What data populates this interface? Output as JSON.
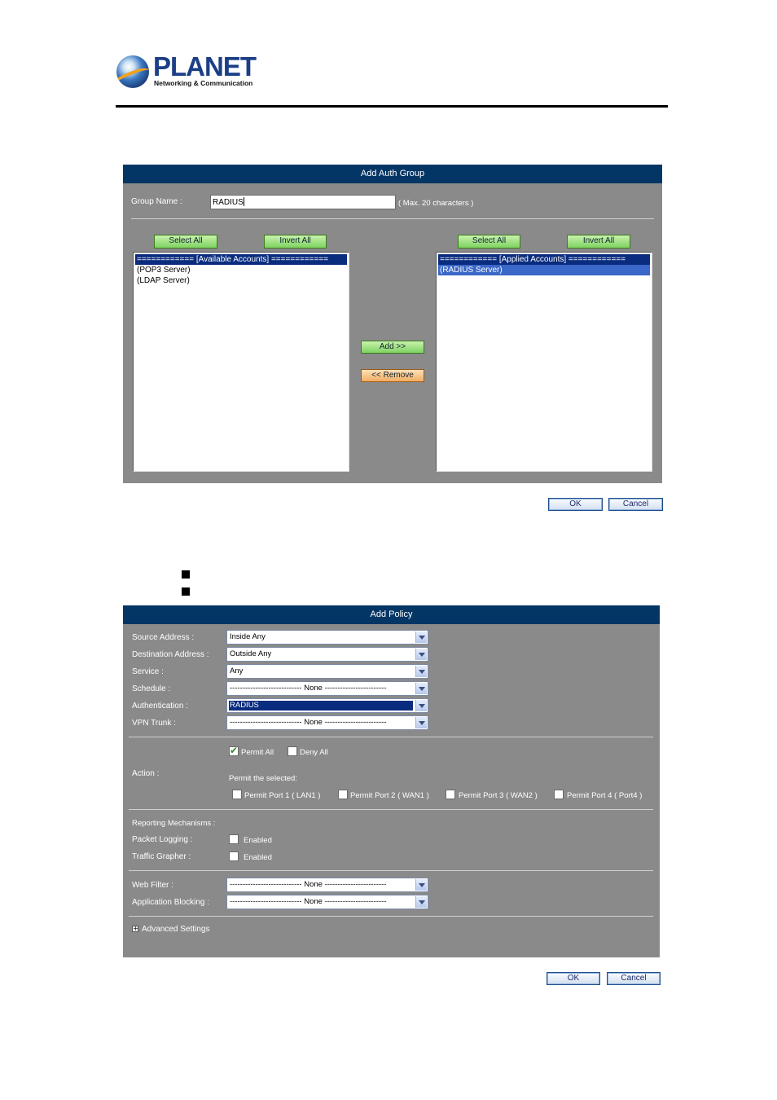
{
  "logo": {
    "name": "PLANET",
    "tagline": "Networking & Communication"
  },
  "auth_group": {
    "title": "Add Auth Group",
    "group_name_label": "Group Name :",
    "group_name_value": "RADIUS",
    "max_hint": "( Max. 20 characters )",
    "available": {
      "select_all": "Select All",
      "invert_all": "Invert All",
      "items": [
        "============ [Available Accounts] ============",
        "(POP3 Server)",
        "(LDAP Server)"
      ]
    },
    "applied": {
      "select_all": "Select All",
      "invert_all": "Invert All",
      "items": [
        "============ [Applied Accounts] ============",
        "(RADIUS Server)"
      ]
    },
    "add_button": "Add >>",
    "remove_button": "<< Remove",
    "ok": "OK",
    "cancel": "Cancel"
  },
  "policy": {
    "title": "Add Policy",
    "fields": {
      "source_address": {
        "label": "Source Address :",
        "value": "Inside Any"
      },
      "destination_address": {
        "label": "Destination Address :",
        "value": "Outside Any"
      },
      "service": {
        "label": "Service :",
        "value": "Any"
      },
      "schedule": {
        "label": "Schedule :",
        "value": "---------------------------- None ------------------------"
      },
      "authentication": {
        "label": "Authentication :",
        "value": "RADIUS"
      },
      "vpn_trunk": {
        "label": "VPN Trunk :",
        "value": "---------------------------- None ------------------------"
      }
    },
    "action": {
      "label": "Action :",
      "permit_all": "Permit All",
      "permit_all_checked": true,
      "deny_all": "Deny All",
      "permit_selected": "Permit the selected:",
      "ports": [
        "Permit Port 1 ( LAN1 )",
        "Permit Port 2 ( WAN1 )",
        "Permit Port 3 ( WAN2 )",
        "Permit Port 4 ( Port4 )"
      ]
    },
    "reporting": {
      "label": "Reporting Mechanisms :",
      "packet_logging": "Packet Logging :",
      "traffic_grapher": "Traffic Grapher :",
      "enabled": "Enabled"
    },
    "web_filter": {
      "label": "Web Filter :",
      "value": "---------------------------- None ------------------------"
    },
    "application_blocking": {
      "label": "Application Blocking :",
      "value": "---------------------------- None ------------------------"
    },
    "advanced": "Advanced Settings",
    "ok": "OK",
    "cancel": "Cancel"
  },
  "colors": {
    "header": "#043665",
    "panel": "#8a8a8a",
    "green_button": "#7ed261",
    "orange_button": "#f0ad62"
  },
  "icons": [
    "planet-globe-icon",
    "bullet-icon",
    "dropdown-arrow-icon",
    "checkbox-check-icon",
    "expand-plus-icon"
  ]
}
